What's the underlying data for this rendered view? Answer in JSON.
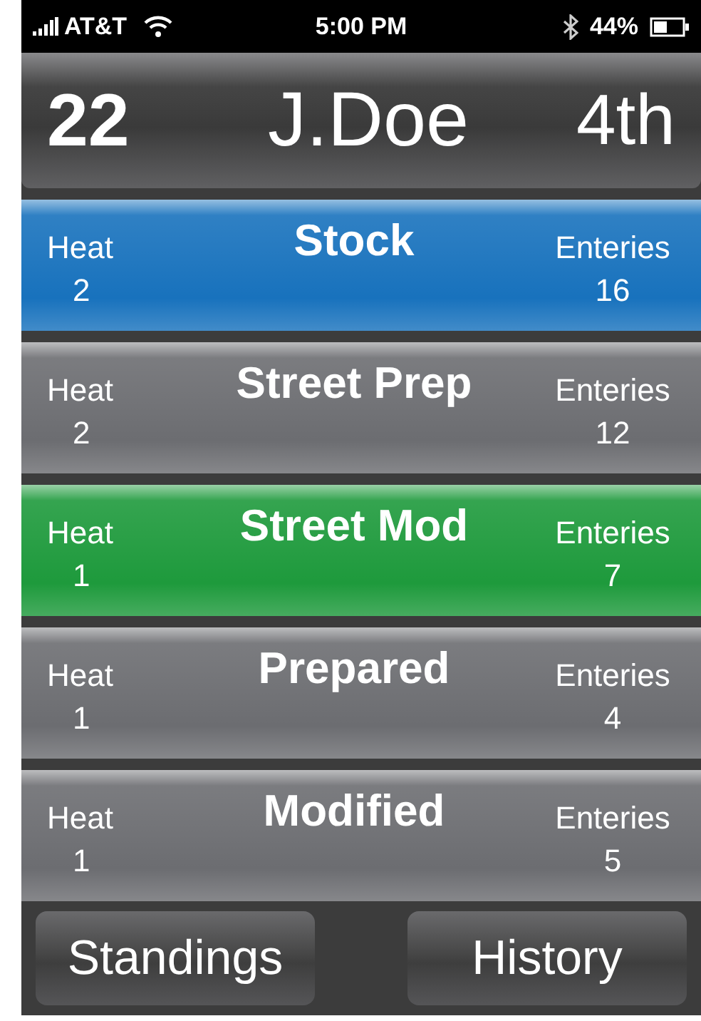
{
  "status_bar": {
    "carrier": "AT&T",
    "time": "5:00 PM",
    "battery": "44%"
  },
  "header": {
    "number": "22",
    "driver": "J.Doe",
    "position": "4th"
  },
  "classes": [
    {
      "name": "Stock",
      "heat_label": "Heat",
      "heat": "2",
      "entries_label": "Enteries",
      "entries": "16",
      "color": "#1872bd"
    },
    {
      "name": "Street Prep",
      "heat_label": "Heat",
      "heat": "2",
      "entries_label": "Enteries",
      "entries": "12",
      "color": "#6c6d71"
    },
    {
      "name": "Street Mod",
      "heat_label": "Heat",
      "heat": "1",
      "entries_label": "Enteries",
      "entries": "7",
      "color": "#1e9a3c"
    },
    {
      "name": "Prepared",
      "heat_label": "Heat",
      "heat": "1",
      "entries_label": "Enteries",
      "entries": "4",
      "color": "#6c6d71"
    },
    {
      "name": "Modified",
      "heat_label": "Heat",
      "heat": "1",
      "entries_label": "Enteries",
      "entries": "5",
      "color": "#6c6d71"
    }
  ],
  "buttons": [
    "Standings",
    "History"
  ]
}
